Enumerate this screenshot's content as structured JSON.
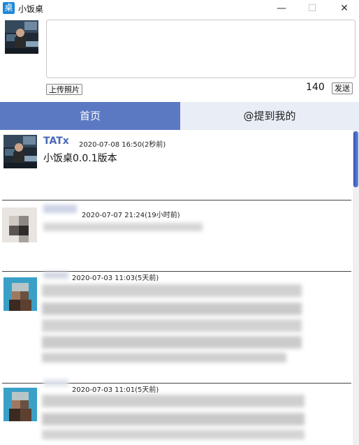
{
  "window": {
    "title": "小饭桌",
    "app_icon_glyph": "桌",
    "minimize_glyph": "—",
    "maximize_glyph": "☐",
    "close_glyph": "✕"
  },
  "compose": {
    "upload_label": "上传照片",
    "char_count": "140",
    "send_label": "发送"
  },
  "tabs": {
    "home_label": "首页",
    "mention_label": "@提到我的"
  },
  "posts": [
    {
      "author": "TATx",
      "time": "2020-07-08 16:50(2秒前)",
      "text": "小饭桌0.0.1版本"
    },
    {
      "author": "",
      "time": "2020-07-07 21:24(19小时前)",
      "text": ""
    },
    {
      "author": "",
      "time": "2020-07-03 11:03(5天前)",
      "text": ""
    },
    {
      "author": "",
      "time": "2020-07-03 11:01(5天前)",
      "text": ""
    }
  ],
  "colors": {
    "tab_active": "#5b79c3",
    "tab_inactive": "#e9edf6",
    "name": "#4a69b8"
  }
}
